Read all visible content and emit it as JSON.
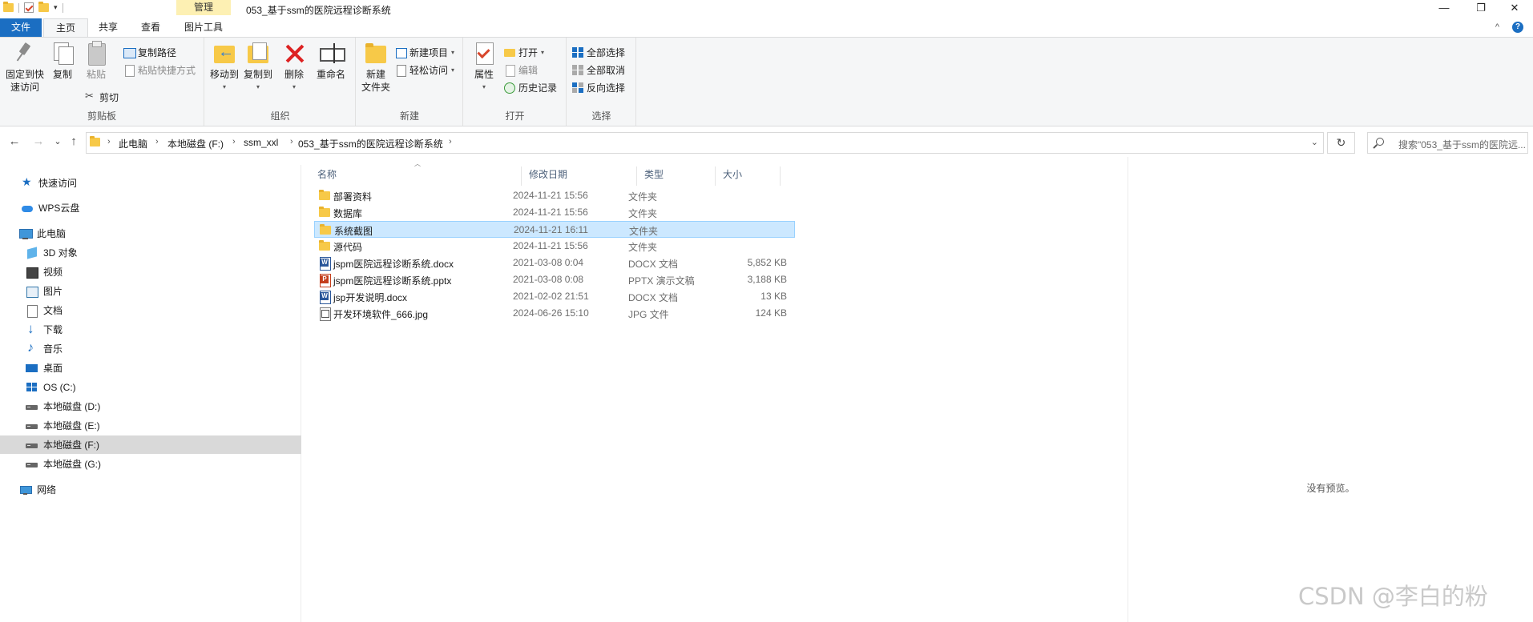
{
  "title_bar": {
    "manage_tab": "管理",
    "window_title": "053_基于ssm的医院远程诊断系统",
    "minimize": "—",
    "maximize": "❐",
    "close": "✕"
  },
  "ribbon_tabs": {
    "file": "文件",
    "home": "主页",
    "share": "共享",
    "view": "查看",
    "picture_tools": "图片工具",
    "collapse": "^",
    "help": "?"
  },
  "ribbon": {
    "clipboard": {
      "pin_quick_access_line1": "固定到快",
      "pin_quick_access_line2": "速访问",
      "copy": "复制",
      "paste": "粘贴",
      "copy_path": "复制路径",
      "paste_shortcut": "粘贴快捷方式",
      "cut": "剪切",
      "group_label": "剪贴板"
    },
    "organize": {
      "move_to": "移动到",
      "copy_to": "复制到",
      "delete": "删除",
      "rename": "重命名",
      "group_label": "组织"
    },
    "new": {
      "new_folder_line1": "新建",
      "new_folder_line2": "文件夹",
      "new_item": "新建项目",
      "easy_access": "轻松访问",
      "group_label": "新建"
    },
    "open": {
      "properties": "属性",
      "open": "打开",
      "edit": "编辑",
      "history": "历史记录",
      "group_label": "打开"
    },
    "select": {
      "select_all": "全部选择",
      "select_none": "全部取消",
      "invert_selection": "反向选择",
      "group_label": "选择"
    }
  },
  "nav_buttons": {
    "back": "←",
    "forward": "→",
    "recent": "⌄",
    "up": "↑",
    "refresh": "↻"
  },
  "breadcrumb": [
    "此电脑",
    "本地磁盘 (F:)",
    "ssm_xxl",
    "053_基于ssm的医院远程诊断系统"
  ],
  "search": {
    "placeholder": "搜索\"053_基于ssm的医院远..."
  },
  "nav_pane": [
    {
      "label": "快速访问",
      "icon": "star-icon"
    },
    {
      "label": "WPS云盘",
      "icon": "cloud-icon"
    },
    {
      "label": "此电脑",
      "icon": "computer-icon"
    },
    {
      "label": "3D 对象",
      "icon": "3d-objects-icon"
    },
    {
      "label": "视频",
      "icon": "video-icon"
    },
    {
      "label": "图片",
      "icon": "pictures-icon"
    },
    {
      "label": "文档",
      "icon": "documents-icon"
    },
    {
      "label": "下载",
      "icon": "download-icon"
    },
    {
      "label": "音乐",
      "icon": "music-icon"
    },
    {
      "label": "桌面",
      "icon": "desktop-icon"
    },
    {
      "label": "OS (C:)",
      "icon": "os-drive-icon"
    },
    {
      "label": "本地磁盘 (D:)",
      "icon": "drive-icon"
    },
    {
      "label": "本地磁盘 (E:)",
      "icon": "drive-icon"
    },
    {
      "label": "本地磁盘 (F:)",
      "icon": "drive-icon",
      "selected": true
    },
    {
      "label": "本地磁盘 (G:)",
      "icon": "drive-icon"
    },
    {
      "label": "网络",
      "icon": "network-icon"
    }
  ],
  "columns": {
    "name": "名称",
    "date": "修改日期",
    "type": "类型",
    "size": "大小"
  },
  "files": [
    {
      "name": "部署资料",
      "date": "2024-11-21 15:56",
      "type": "文件夹",
      "size": "",
      "icon": "folder-icon"
    },
    {
      "name": "数据库",
      "date": "2024-11-21 15:56",
      "type": "文件夹",
      "size": "",
      "icon": "folder-icon"
    },
    {
      "name": "系统截图",
      "date": "2024-11-21 16:11",
      "type": "文件夹",
      "size": "",
      "icon": "folder-icon",
      "selected": true
    },
    {
      "name": "源代码",
      "date": "2024-11-21 15:56",
      "type": "文件夹",
      "size": "",
      "icon": "folder-icon"
    },
    {
      "name": "jspm医院远程诊断系统.docx",
      "date": "2021-03-08 0:04",
      "type": "DOCX 文档",
      "size": "5,852 KB",
      "icon": "word-doc-icon"
    },
    {
      "name": "jspm医院远程诊断系统.pptx",
      "date": "2021-03-08 0:08",
      "type": "PPTX 演示文稿",
      "size": "3,188 KB",
      "icon": "powerpoint-icon"
    },
    {
      "name": "jsp开发说明.docx",
      "date": "2021-02-02 21:51",
      "type": "DOCX 文档",
      "size": "13 KB",
      "icon": "word-doc-icon"
    },
    {
      "name": "开发环境软件_666.jpg",
      "date": "2024-06-26 15:10",
      "type": "JPG 文件",
      "size": "124 KB",
      "icon": "image-file-icon"
    }
  ],
  "preview": {
    "empty_text": "没有预览。"
  },
  "watermark": "CSDN @李白的粉",
  "colors": {
    "accent": "#1b6ec2",
    "manage_tab_bg": "#fdf0b3",
    "selection_bg": "#cce8ff",
    "folder": "#f7c948"
  }
}
